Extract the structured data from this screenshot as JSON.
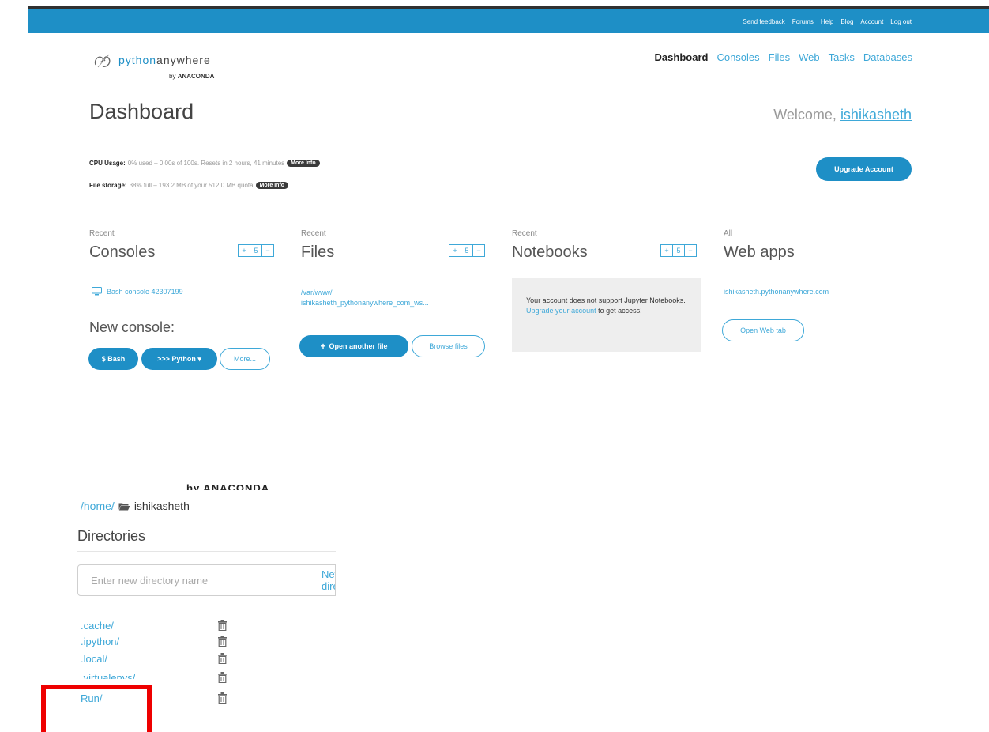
{
  "topbar": {
    "links": [
      "Send feedback",
      "Forums",
      "Help",
      "Blog",
      "Account",
      "Log out"
    ]
  },
  "logo": {
    "word_a": "python",
    "word_b": "anywhere",
    "by": "by",
    "brand": "ANACONDA"
  },
  "nav": {
    "items": [
      "Dashboard",
      "Consoles",
      "Files",
      "Web",
      "Tasks",
      "Databases"
    ],
    "active": "Dashboard"
  },
  "page": {
    "title": "Dashboard",
    "welcome_prefix": "Welcome,",
    "username": "ishikasheth"
  },
  "usage": {
    "cpu_label": "CPU Usage:",
    "cpu_text": "0% used – 0.00s of 100s. Resets in 2 hours, 41 minutes",
    "storage_label": "File storage:",
    "storage_text": "38% full – 193.2 MB of your 512.0 MB quota",
    "more_info": "More Info",
    "upgrade_button": "Upgrade Account"
  },
  "columns": {
    "consoles": {
      "sub": "Recent",
      "title": "Consoles",
      "pm": [
        "+",
        "5",
        "−"
      ],
      "recent_item": "Bash console 42307199",
      "new_console_label": "New console:",
      "buttons": {
        "bash": "$ Bash",
        "python": ">>> Python ▾",
        "more": "More..."
      }
    },
    "files": {
      "sub": "Recent",
      "title": "Files",
      "pm": [
        "+",
        "5",
        "−"
      ],
      "path_line1": "/var/www/",
      "path_line2": "ishikasheth_pythonanywhere_com_ws...",
      "open_another": "Open another file",
      "browse": "Browse files"
    },
    "notebooks": {
      "sub": "Recent",
      "title": "Notebooks",
      "pm": [
        "+",
        "5",
        "−"
      ],
      "msg_a": "Your account does not support Jupyter Notebooks.",
      "msg_link_a": "Upgrade your",
      "msg_link_b": "account",
      "msg_b": "to get access!"
    },
    "webapps": {
      "sub": "All",
      "title": "Web apps",
      "app": "ishikasheth.pythonanywhere.com",
      "open_tab": "Open Web tab"
    }
  },
  "files_page": {
    "crop_artifact": "by ANACONDA",
    "path_home": "/home/",
    "path_user": "ishikasheth",
    "directories_title": "Directories",
    "new_dir_placeholder": "Enter new directory name",
    "new_dir_button": "New directory",
    "dirs": [
      ".cache/",
      ".ipython/",
      ".local/",
      ".virtualenvs/",
      "Run/"
    ]
  },
  "colors": {
    "brand_blue": "#1e8fc6",
    "link_blue": "#3ea8d8",
    "highlight_red": "#ee0000"
  }
}
